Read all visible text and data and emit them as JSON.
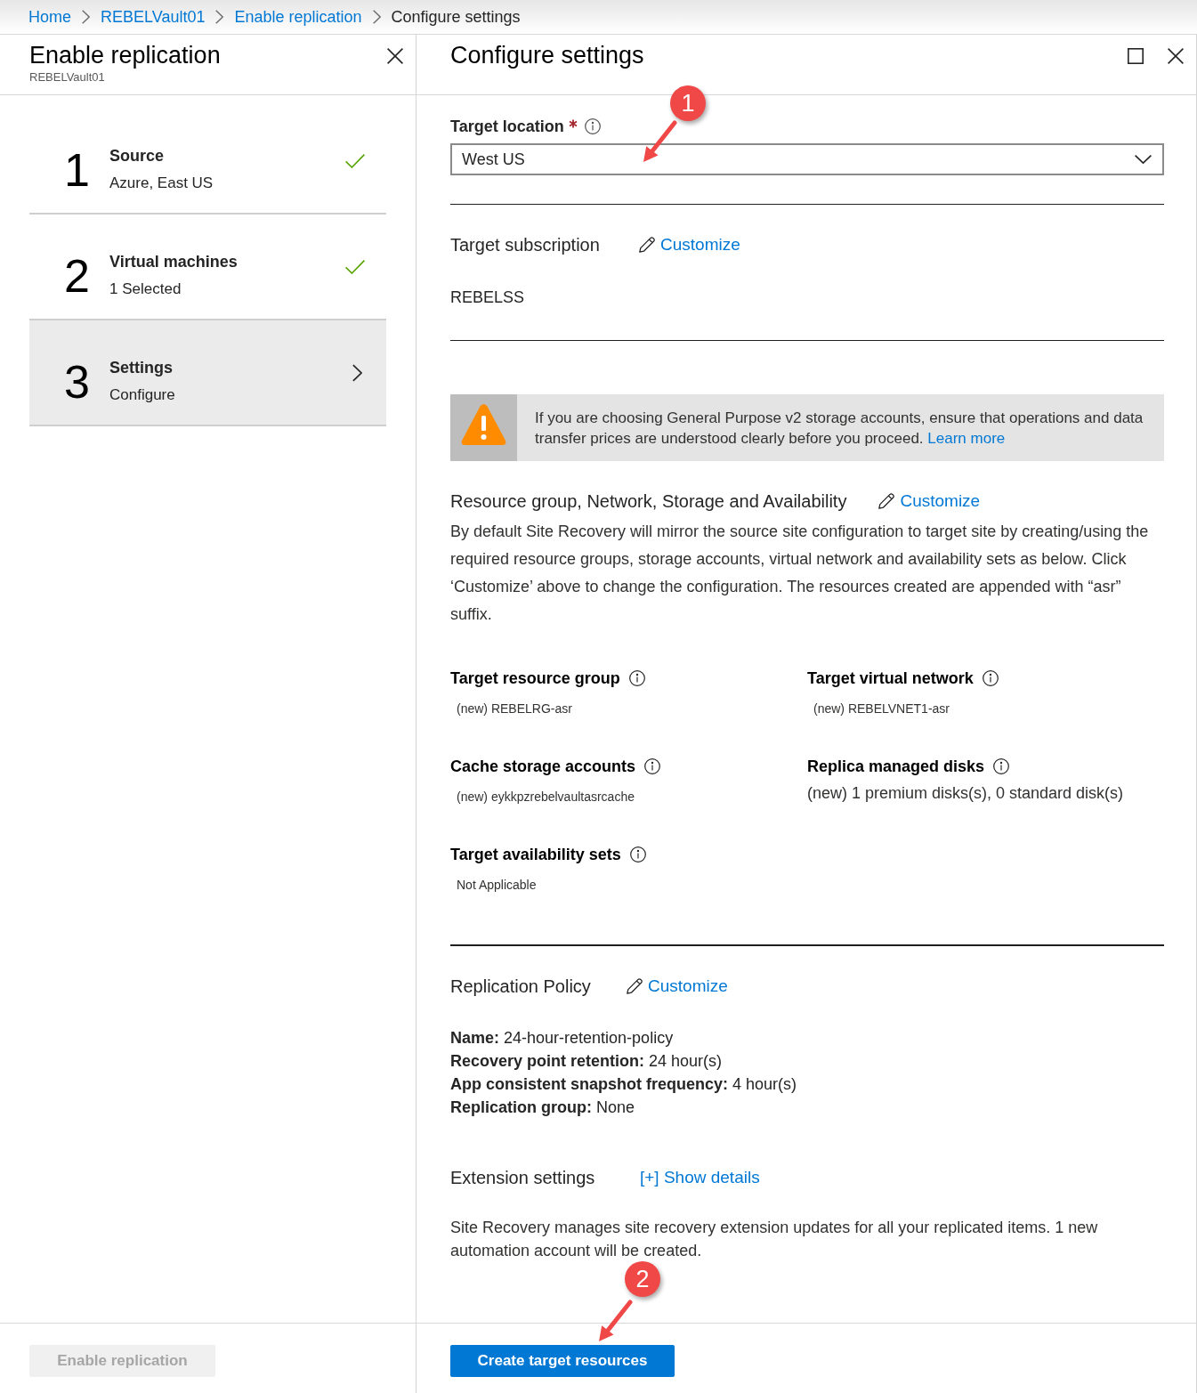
{
  "breadcrumb": [
    {
      "label": "Home",
      "current": false
    },
    {
      "label": "REBELVault01",
      "current": false
    },
    {
      "label": "Enable replication",
      "current": false
    },
    {
      "label": "Configure settings",
      "current": true
    }
  ],
  "left_blade": {
    "title": "Enable replication",
    "subtitle": "REBELVault01",
    "steps": [
      {
        "number": "1",
        "title": "Source",
        "detail": "Azure, East US",
        "completed": true,
        "selected": false
      },
      {
        "number": "2",
        "title": "Virtual machines",
        "detail": "1 Selected",
        "completed": true,
        "selected": false
      },
      {
        "number": "3",
        "title": "Settings",
        "detail": "Configure",
        "completed": false,
        "selected": true
      }
    ],
    "footer_button": {
      "label": "Enable replication",
      "disabled": true
    }
  },
  "right_blade": {
    "title": "Configure settings",
    "target_location": {
      "label": "Target location",
      "required": true,
      "value": "West US"
    },
    "target_subscription": {
      "label": "Target subscription",
      "action": "Customize",
      "value": "REBELSS"
    },
    "warning": {
      "text": "If you are choosing General Purpose v2 storage accounts, ensure that operations and data transfer prices are understood clearly before you proceed.",
      "link": "Learn more"
    },
    "resources": {
      "heading": "Resource group, Network, Storage and Availability",
      "action": "Customize",
      "description": "By default Site Recovery will mirror the source site configuration to target site by creating/using the required resource groups, storage accounts, virtual network and availability sets as below. Click ‘Customize’ above to change the configuration. The resources created are appended with “asr” suffix.",
      "fields": [
        {
          "label": "Target resource group",
          "value": "(new) REBELRG-asr",
          "kind": "small"
        },
        {
          "label": "Target virtual network",
          "value": "(new) REBELVNET1-asr",
          "kind": "small"
        },
        {
          "label": "Cache storage accounts",
          "value": "(new) eykkpzrebelvaultasrcache",
          "kind": "small"
        },
        {
          "label": "Replica managed disks",
          "value": "(new) 1 premium disks(s), 0 standard disk(s)",
          "kind": "large"
        },
        {
          "label": "Target availability sets",
          "value": "Not Applicable",
          "kind": "small"
        }
      ]
    },
    "replication_policy": {
      "heading": "Replication Policy",
      "action": "Customize",
      "lines": [
        "**Name:** 24-hour-retention-policy",
        "**Recovery point retention:** 24 hour(s)",
        "**App consistent snapshot frequency:** 4 hour(s)",
        "**Replication group:** None"
      ]
    },
    "extension_settings": {
      "heading": "Extension settings",
      "action": "[+] Show details",
      "description": "Site Recovery manages site recovery extension updates for all your replicated items. 1 new automation account will be created."
    },
    "footer_button": {
      "label": "Create target resources",
      "disabled": false
    }
  },
  "annotations": [
    {
      "number": "1"
    },
    {
      "number": "2"
    }
  ]
}
